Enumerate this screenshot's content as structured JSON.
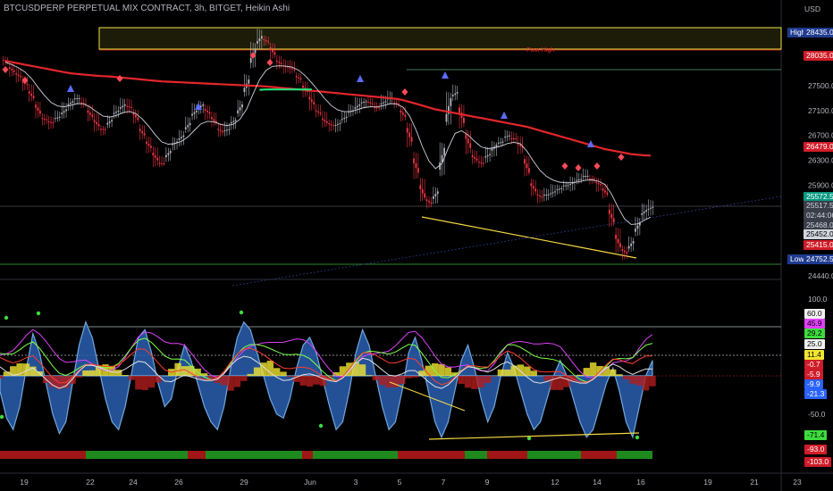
{
  "header": {
    "title": "BTCUSDPERP PERPETUAL MIX CONTRACT, 3h, BITGET, Heikin Ashi",
    "currency": "USD"
  },
  "annotations": {
    "poor_high": "Poor High"
  },
  "colors": {
    "background": "#000000",
    "bull_candle": "#b2b5be",
    "bear_candle": "#f23645",
    "ema_red": "#e3262b",
    "ema_green": "#26e07a",
    "zone_yellow": "#f0e442",
    "trend_line": "#f5d742",
    "buy_triangle": "#5b6cff",
    "sell_diamond": "#ff4a5a",
    "osc_blue": "#2962ff",
    "osc_yellow": "#f2e530",
    "osc_red": "#b21d1d",
    "bar_green": "#1e8a1e",
    "bar_red": "#a01515"
  },
  "chart_data": [
    {
      "type": "candlestick",
      "name": "price",
      "style": "Heikin Ashi",
      "y_ticks": [
        "27500.0",
        "27100.0",
        "26700.0",
        "26300.0",
        "25900.0",
        "24440.0"
      ],
      "y_ticks_values": [
        27500,
        27100,
        26700,
        26300,
        25900,
        24440
      ],
      "x_ticks": [
        "19",
        "22",
        "24",
        "26",
        "29",
        "Jun",
        "3",
        "5",
        "7",
        "9",
        "12",
        "14",
        "16",
        "19",
        "21",
        "23"
      ],
      "price_labels": [
        {
          "text": "High",
          "value": "28435.0",
          "style": "high"
        },
        {
          "text": "",
          "value": "28035.0",
          "style": "red"
        },
        {
          "text": "",
          "value": "26479.0",
          "style": "red"
        },
        {
          "text": "",
          "value": "25572.5",
          "style": "teal"
        },
        {
          "text": "",
          "value": "25517.5",
          "style": "gray"
        },
        {
          "text": "",
          "value": "02:44:06",
          "style": "gray"
        },
        {
          "text": "",
          "value": "25468.0",
          "style": "gray"
        },
        {
          "text": "",
          "value": "25452.0",
          "style": "white"
        },
        {
          "text": "",
          "value": "25415.0",
          "style": "red"
        },
        {
          "text": "Low",
          "value": "24752.5",
          "style": "low"
        }
      ],
      "close_series": [
        27880,
        27720,
        27640,
        27520,
        27300,
        27050,
        26950,
        26900,
        27000,
        27120,
        27250,
        27300,
        27200,
        27000,
        26850,
        26800,
        26950,
        27100,
        27200,
        27150,
        26950,
        26700,
        26500,
        26300,
        26250,
        26450,
        26600,
        26700,
        26900,
        27100,
        27200,
        27050,
        26900,
        26750,
        26800,
        26950,
        27200,
        27600,
        28100,
        28300,
        28200,
        28000,
        27850,
        27800,
        27750,
        27600,
        27400,
        27200,
        27050,
        26900,
        26850,
        26900,
        27000,
        27100,
        27200,
        27250,
        27200,
        27150,
        27250,
        27300,
        27200,
        27000,
        26600,
        26100,
        25700,
        25600,
        25800,
        26500,
        27300,
        27400,
        26900,
        26500,
        26300,
        26250,
        26400,
        26550,
        26600,
        26700,
        26650,
        26500,
        26100,
        25800,
        25700,
        25750,
        25800,
        25850,
        25900,
        25950,
        26000,
        26050,
        26000,
        25900,
        25750,
        25300,
        24900,
        24800,
        25000,
        25300,
        25500,
        25550
      ],
      "ema_red_series": [
        27900,
        27880,
        27860,
        27840,
        27820,
        27800,
        27780,
        27760,
        27740,
        27720,
        27700,
        27690,
        27680,
        27670,
        27660,
        27655,
        27650,
        27640,
        27630,
        27620,
        27610,
        27600,
        27590,
        27580,
        27570,
        27565,
        27560,
        27555,
        27550,
        27545,
        27540,
        27535,
        27530,
        27525,
        27520,
        27515,
        27510,
        27505,
        27500,
        27495,
        27490,
        27480,
        27470,
        27460,
        27450,
        27440,
        27430,
        27420,
        27410,
        27400,
        27390,
        27380,
        27370,
        27360,
        27350,
        27340,
        27330,
        27320,
        27310,
        27300,
        27290,
        27270,
        27240,
        27210,
        27180,
        27150,
        27120,
        27100,
        27080,
        27060,
        27040,
        27020,
        27000,
        26980,
        26960,
        26940,
        26920,
        26900,
        26880,
        26860,
        26840,
        26810,
        26780,
        26750,
        26720,
        26690,
        26660,
        26630,
        26600,
        26570,
        26540,
        26510,
        26480,
        26460,
        26440,
        26420,
        26400,
        26390,
        26380,
        26375
      ]
    },
    {
      "type": "line",
      "name": "oscillator",
      "y_ticks": [
        "100.0",
        "-50.0"
      ],
      "y_ticks_values": [
        100,
        -50
      ],
      "right_labels": [
        {
          "value": "60.0",
          "style": "white"
        },
        {
          "value": "45.9",
          "style": "magenta"
        },
        {
          "value": "29.2",
          "style": "green"
        },
        {
          "value": "25.0",
          "style": "white"
        },
        {
          "value": "11.4",
          "style": "yellow"
        },
        {
          "value": "-0.7",
          "style": "red"
        },
        {
          "value": "-5.9",
          "style": "red"
        },
        {
          "value": "-9.9",
          "style": "blue"
        },
        {
          "value": "-21.3",
          "style": "blue"
        },
        {
          "value": "-71.4",
          "style": "green"
        },
        {
          "value": "-93.0",
          "style": "red"
        },
        {
          "value": "-103.0",
          "style": "red"
        }
      ],
      "series": [
        {
          "values": [
            -20,
            -55,
            -70,
            -40,
            10,
            55,
            30,
            -10,
            -50,
            -75,
            -60,
            -10,
            40,
            70,
            50,
            10,
            -30,
            -60,
            -70,
            -40,
            5,
            50,
            60,
            30,
            -10,
            -40,
            -30,
            10,
            40,
            20,
            -10,
            -40,
            -60,
            -70,
            -40,
            10,
            50,
            70,
            60,
            30,
            0,
            -30,
            -50,
            -55,
            -30,
            10,
            40,
            50,
            30,
            -5,
            -40,
            -70,
            -60,
            -20,
            30,
            60,
            40,
            0,
            -40,
            -70,
            -60,
            -20,
            30,
            50,
            20,
            -20,
            -60,
            -80,
            -60,
            -20,
            20,
            40,
            10,
            -30,
            -60,
            -40,
            0,
            30,
            10,
            -20,
            -50,
            -70,
            -60,
            -30,
            0,
            20,
            0,
            -30,
            -60,
            -80,
            -70,
            -40,
            -10,
            10,
            -20,
            -60,
            -80,
            -40,
            0,
            20
          ]
        }
      ]
    }
  ]
}
